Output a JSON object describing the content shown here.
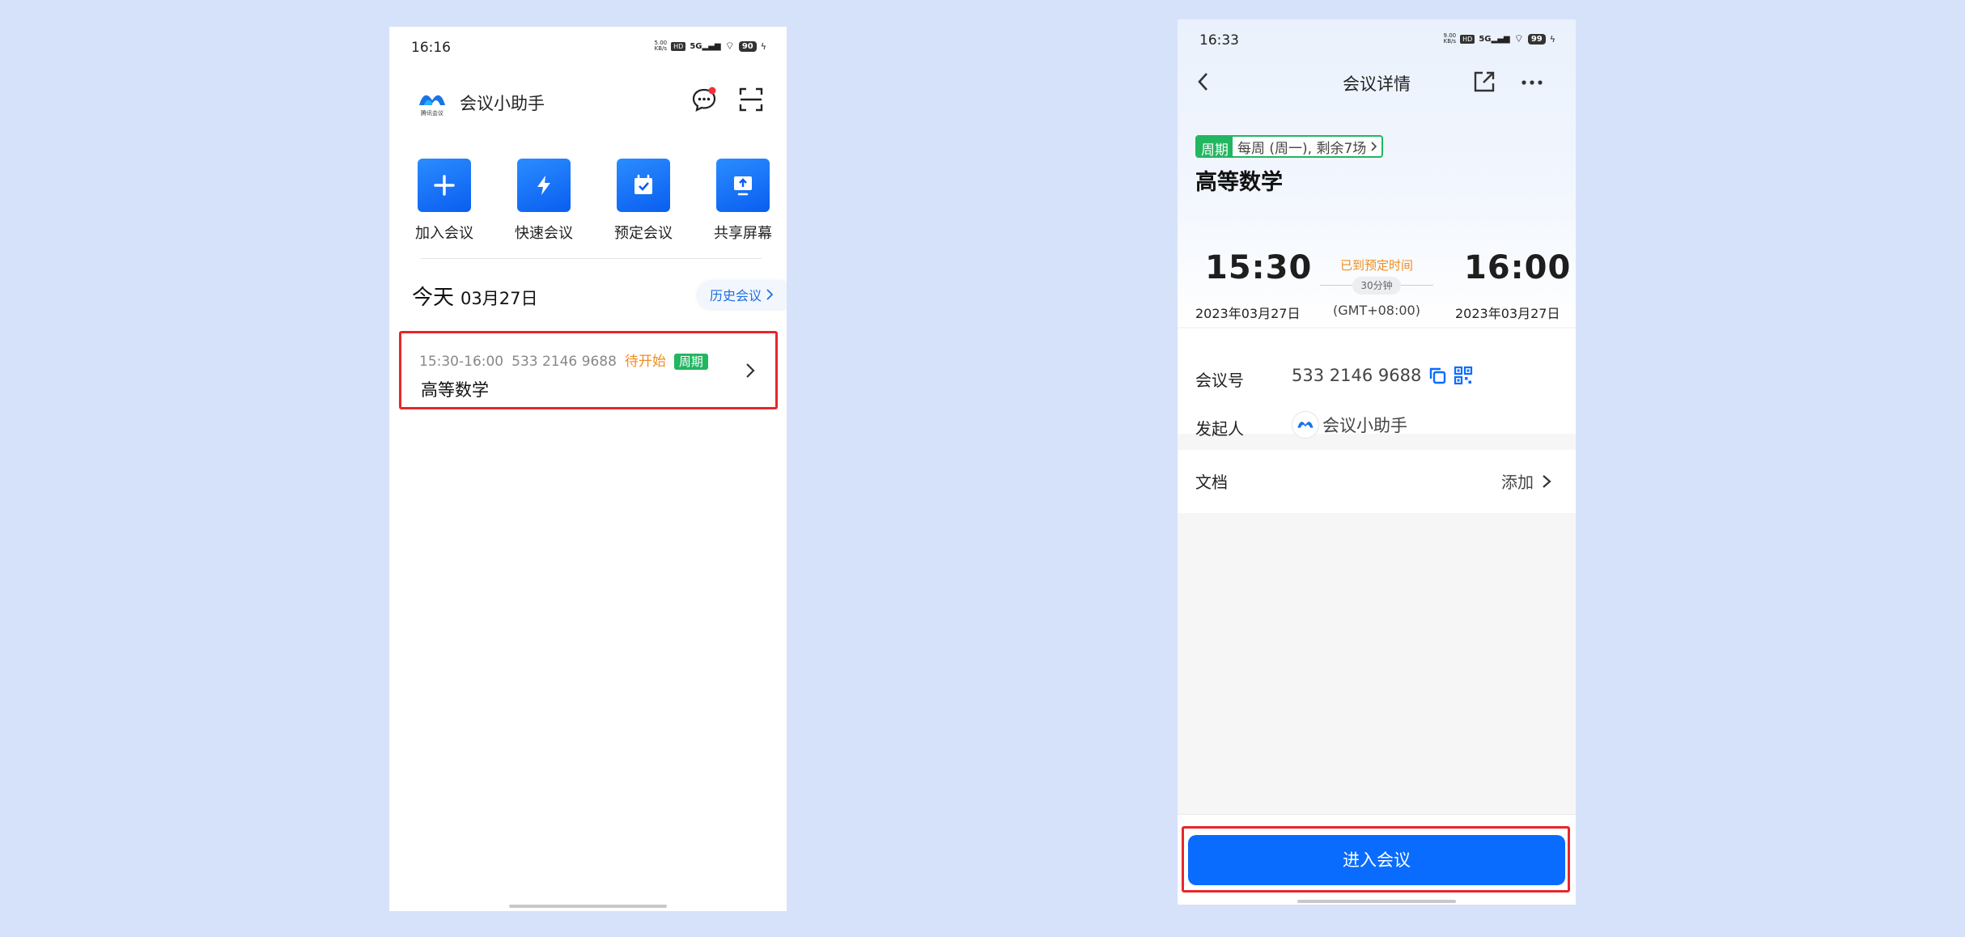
{
  "left_screen": {
    "status": {
      "time": "16:16",
      "speed": "5.00\nKB/s",
      "hd": "HD",
      "net": "5G",
      "battery": "90"
    },
    "header": {
      "app_title": "会议小助手",
      "logo_caption": "腾讯会议"
    },
    "actions": [
      {
        "label": "加入会议",
        "icon": "plus-icon"
      },
      {
        "label": "快速会议",
        "icon": "lightning-icon"
      },
      {
        "label": "预定会议",
        "icon": "calendar-check-icon"
      },
      {
        "label": "共享屏幕",
        "icon": "screen-share-icon"
      }
    ],
    "today": {
      "label": "今天",
      "date": "03月27日",
      "history_label": "历史会议"
    },
    "meeting": {
      "time_range": "15:30-16:00",
      "number": "533 2146 9688",
      "status": "待开始",
      "tag": "周期",
      "title": "高等数学"
    }
  },
  "right_screen": {
    "status": {
      "time": "16:33",
      "speed": "9.00\nKB/s",
      "hd": "HD",
      "net": "5G",
      "battery": "99"
    },
    "nav": {
      "title": "会议详情"
    },
    "cycle": {
      "tag": "周期",
      "text": "每周 (周一), 剩余7场"
    },
    "meeting_title": "高等数学",
    "times": {
      "start": "15:30",
      "start_date": "2023年03月27日",
      "status": "已到预定时间",
      "duration": "30分钟",
      "timezone": "(GMT+08:00)",
      "end": "16:00",
      "end_date": "2023年03月27日"
    },
    "info": {
      "number_label": "会议号",
      "number_value": "533 2146 9688",
      "host_label": "发起人",
      "host_value": "会议小助手"
    },
    "docs": {
      "label": "文档",
      "action": "添加"
    },
    "enter_button": "进入会议"
  },
  "colors": {
    "background": "#d6e2fa",
    "primary": "#0a6cff",
    "green_tag": "#22b660",
    "orange_status": "#f08c1e",
    "highlight_red": "#e8262a"
  }
}
